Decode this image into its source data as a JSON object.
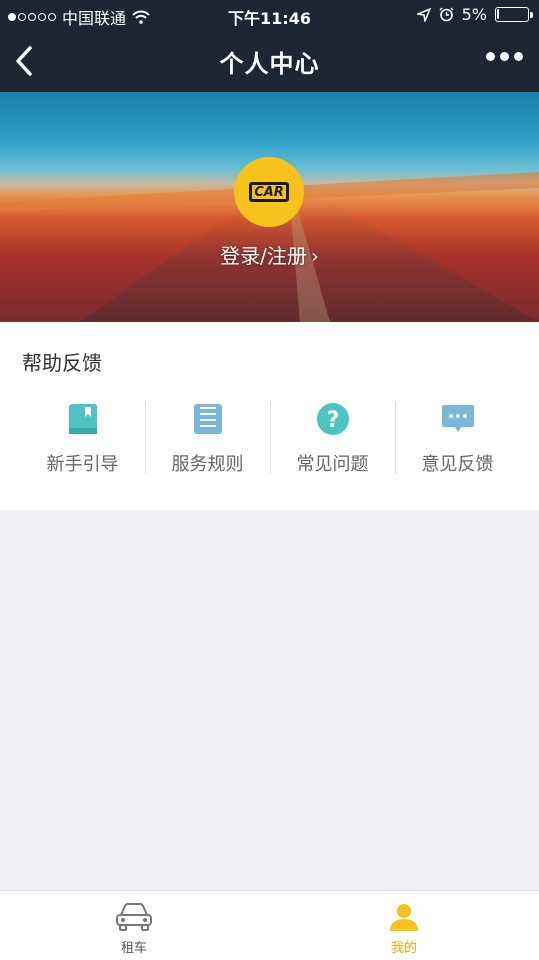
{
  "status_bar": {
    "carrier": "中国联通",
    "time": "下午11:46",
    "battery": "5%",
    "battery_level": 0.05
  },
  "nav": {
    "title": "个人中心"
  },
  "profile": {
    "logo_text": "CAR",
    "login_label": "登录/注册",
    "chevron": "›"
  },
  "help": {
    "title": "帮助反馈",
    "items": [
      {
        "label": "新手引导",
        "icon": "book-icon"
      },
      {
        "label": "服务规则",
        "icon": "list-icon"
      },
      {
        "label": "常见问题",
        "icon": "question-icon"
      },
      {
        "label": "意见反馈",
        "icon": "chat-icon"
      }
    ]
  },
  "tabbar": {
    "items": [
      {
        "label": "租车",
        "icon": "car-icon"
      },
      {
        "label": "我的",
        "icon": "user-icon"
      }
    ]
  },
  "colors": {
    "nav_bg": "#1f2633",
    "accent": "#f7c21b",
    "icon_teal": "#4dc4c1",
    "icon_blue": "#7ab6d8"
  }
}
